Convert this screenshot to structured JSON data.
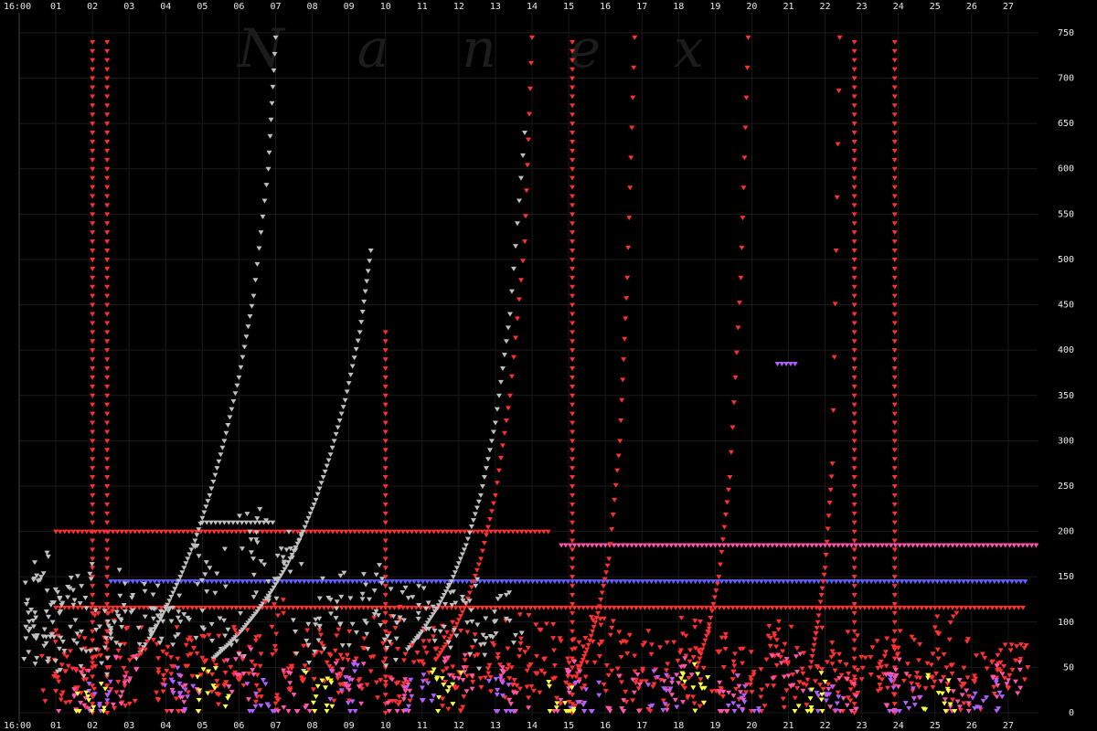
{
  "chart_data": {
    "type": "scatter",
    "title": "",
    "xlabel": "",
    "ylabel": "",
    "watermark": "Nanex",
    "background": "#000000",
    "grid": true,
    "legend": "none",
    "x_tick_labels": [
      "16:00",
      "01",
      "02",
      "03",
      "04",
      "05",
      "06",
      "07",
      "08",
      "09",
      "10",
      "11",
      "12",
      "13",
      "14",
      "15",
      "16",
      "17",
      "18",
      "19",
      "20",
      "21",
      "22",
      "23",
      "24",
      "25",
      "26",
      "27"
    ],
    "x_range": [
      0,
      27.8
    ],
    "y_ticks": [
      0,
      50,
      100,
      150,
      200,
      250,
      300,
      350,
      400,
      450,
      500,
      550,
      600,
      650,
      700,
      750
    ],
    "ylim": [
      0,
      760
    ],
    "marker": "down-triangle",
    "palette": [
      "#ff3030",
      "#c0c0c0",
      "#ff55aa",
      "#b060ff",
      "#ffff40",
      "#40ff40",
      "#40c0ff",
      "#ffaa00"
    ],
    "series": [
      {
        "color": "#ff3030",
        "x": [
          1.0,
          1.3,
          1.6,
          2.0,
          2.4,
          2.9,
          3.3,
          3.8,
          4.2,
          4.7,
          5.1,
          5.6,
          6.0,
          6.5,
          6.9,
          7.4,
          7.8,
          8.3,
          8.7,
          9.2,
          9.6,
          10.1,
          10.5,
          11.0,
          11.4,
          11.9,
          12.3,
          12.8,
          13.2,
          13.7,
          14.1,
          14.6,
          15.0,
          15.5,
          15.9,
          16.4,
          16.8,
          17.3,
          17.7,
          18.2,
          18.6,
          19.1,
          19.5,
          20.0,
          20.4,
          20.9,
          21.3,
          21.8,
          22.2,
          22.7,
          23.1,
          23.6,
          24.0,
          24.5,
          24.9,
          25.4,
          25.8,
          26.3,
          26.7,
          27.2
        ],
        "y": [
          40,
          62,
          28,
          55,
          90,
          35,
          70,
          48,
          22,
          80,
          58,
          30,
          66,
          42,
          95,
          25,
          52,
          74,
          38,
          60,
          46,
          88,
          33,
          57,
          71,
          27,
          64,
          49,
          36,
          82,
          44,
          69,
          31,
          56,
          78,
          41,
          63,
          29,
          54,
          85,
          37,
          67,
          45,
          23,
          59,
          76,
          34,
          50,
          68,
          26,
          61,
          43,
          72,
          39,
          53,
          81,
          32,
          65,
          47,
          58
        ]
      },
      {
        "color": "#c0c0c0",
        "x": [
          0.2,
          0.4,
          0.6,
          0.8,
          1.1,
          1.4,
          1.7,
          2.1,
          2.6,
          3.1,
          3.6,
          4.1,
          4.6,
          5.2,
          5.7,
          6.3,
          6.8,
          7.3,
          7.9,
          8.5,
          9.1,
          9.7,
          10.3,
          10.9,
          11.5,
          12.1,
          12.7,
          13.3
        ],
        "y": [
          120,
          85,
          150,
          60,
          110,
          95,
          140,
          70,
          100,
          130,
          88,
          115,
          105,
          160,
          92,
          200,
          145,
          180,
          75,
          125,
          98,
          135,
          82,
          110,
          90,
          128,
          76,
          104
        ]
      },
      {
        "color": "#ff55aa",
        "x": [
          1.5,
          3.0,
          4.5,
          6.0,
          7.5,
          9.0,
          10.5,
          12.0,
          13.5,
          15.0,
          16.5,
          18.0,
          19.5,
          21.0,
          22.5,
          24.0,
          25.5,
          27.0
        ],
        "y": [
          18,
          35,
          12,
          42,
          20,
          30,
          15,
          38,
          22,
          27,
          14,
          33,
          19,
          41,
          16,
          29,
          24,
          36
        ]
      },
      {
        "color": "#b060ff",
        "x": [
          2.2,
          4.4,
          6.6,
          8.8,
          11.0,
          13.2,
          15.4,
          17.6,
          19.8,
          22.0,
          24.2,
          26.4
        ],
        "y": [
          10,
          22,
          8,
          25,
          14,
          19,
          9,
          27,
          12,
          21,
          11,
          17
        ]
      },
      {
        "color": "#ffff40",
        "x": [
          1.9,
          5.3,
          8.1,
          11.7,
          14.9,
          18.4,
          21.6,
          25.1
        ],
        "y": [
          14,
          30,
          18,
          24,
          11,
          28,
          16,
          22
        ]
      }
    ],
    "trajectories": [
      {
        "color": "#c0c0c0",
        "x": [
          3.2,
          3.6,
          4.0,
          4.4,
          4.8,
          5.2,
          5.6,
          6.0,
          6.4,
          6.8,
          7.0
        ],
        "y": [
          60,
          85,
          115,
          150,
          190,
          240,
          300,
          370,
          460,
          600,
          745
        ]
      },
      {
        "color": "#c0c0c0",
        "x": [
          5.3,
          5.7,
          6.1,
          6.5,
          6.9,
          7.3,
          7.7,
          8.1,
          8.5,
          8.9,
          9.3,
          9.6
        ],
        "y": [
          60,
          75,
          92,
          112,
          135,
          162,
          195,
          235,
          285,
          345,
          420,
          510
        ]
      },
      {
        "color": "#c0c0c0",
        "x": [
          10.6,
          11.0,
          11.4,
          11.8,
          12.2,
          12.6,
          13.0,
          13.4,
          13.8
        ],
        "y": [
          70,
          90,
          115,
          145,
          185,
          240,
          320,
          440,
          640
        ]
      },
      {
        "color": "#ff3030",
        "x": [
          11.4,
          11.8,
          12.2,
          12.6,
          13.0,
          13.4,
          13.8,
          14.0
        ],
        "y": [
          60,
          85,
          120,
          170,
          240,
          350,
          520,
          745
        ]
      },
      {
        "color": "#ff3030",
        "x": [
          15.2,
          15.5,
          15.8,
          16.1,
          16.4,
          16.6,
          16.8
        ],
        "y": [
          40,
          70,
          110,
          170,
          300,
          480,
          745
        ]
      },
      {
        "color": "#ff3030",
        "x": [
          18.5,
          18.8,
          19.1,
          19.4,
          19.7,
          19.9
        ],
        "y": [
          50,
          90,
          150,
          260,
          480,
          745
        ]
      },
      {
        "color": "#ff3030",
        "x": [
          21.6,
          21.8,
          22.0,
          22.2,
          22.4
        ],
        "y": [
          50,
          100,
          160,
          275,
          745
        ]
      }
    ],
    "columns": [
      {
        "color": "#ff3030",
        "x": 2.0,
        "y_top": 745
      },
      {
        "color": "#ff3030",
        "x": 2.4,
        "y_top": 745
      },
      {
        "color": "#ff3030",
        "x": 10.0,
        "y_top": 420
      },
      {
        "color": "#ff3030",
        "x": 15.1,
        "y_top": 745
      },
      {
        "color": "#ff3030",
        "x": 22.8,
        "y_top": 745
      },
      {
        "color": "#ff3030",
        "x": 23.9,
        "y_top": 740
      }
    ],
    "levels": [
      {
        "color": "#ff3030",
        "y": 200,
        "x_from": 1.0,
        "x_to": 14.5
      },
      {
        "color": "#ff3030",
        "y": 116,
        "x_from": 1.0,
        "x_to": 27.5
      },
      {
        "color": "#ff55aa",
        "y": 185,
        "x_from": 14.8,
        "x_to": 27.8
      },
      {
        "color": "#6060ff",
        "y": 145,
        "x_from": 2.5,
        "x_to": 27.5
      },
      {
        "color": "#c0c0c0",
        "y": 210,
        "x_from": 5.0,
        "x_to": 7.0
      },
      {
        "color": "#b060ff",
        "y": 385,
        "x_from": 20.7,
        "x_to": 21.3
      }
    ]
  }
}
